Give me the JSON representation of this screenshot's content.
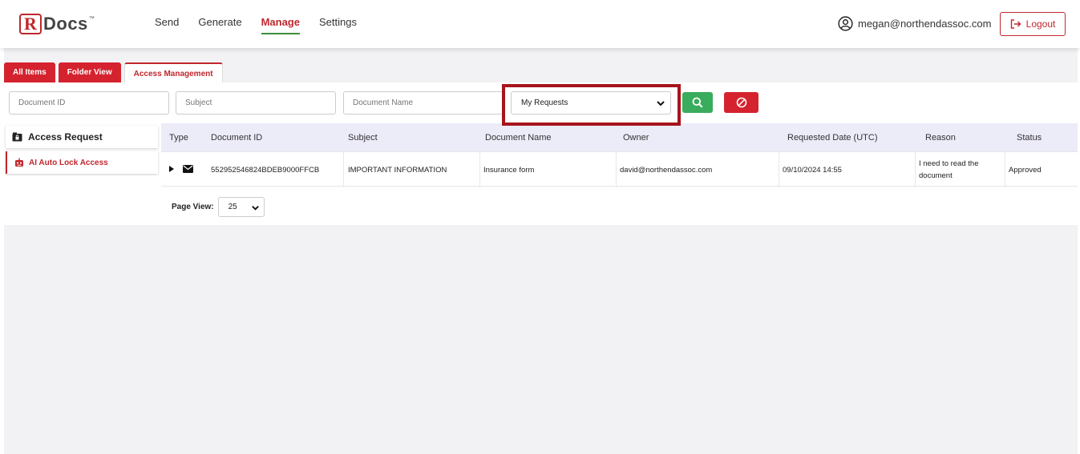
{
  "brand": {
    "logo_r": "R",
    "logo_text": "Docs",
    "logo_tm": "™"
  },
  "nav": {
    "items": [
      {
        "label": "Send",
        "active": false
      },
      {
        "label": "Generate",
        "active": false
      },
      {
        "label": "Manage",
        "active": true
      },
      {
        "label": "Settings",
        "active": false
      }
    ]
  },
  "user": {
    "email": "megan@northendassoc.com",
    "logout_label": "Logout"
  },
  "tabs": [
    {
      "label": "All Items",
      "active": false
    },
    {
      "label": "Folder View",
      "active": false
    },
    {
      "label": "Access Management",
      "active": true
    }
  ],
  "filters": {
    "document_id_placeholder": "Document ID",
    "subject_placeholder": "Subject",
    "document_name_placeholder": "Document Name",
    "request_filter_value": "My Requests"
  },
  "left_panel": {
    "title": "Access Request",
    "items": [
      {
        "label": "AI Auto Lock Access"
      }
    ]
  },
  "table": {
    "headers": [
      "Type",
      "Document ID",
      "Subject",
      "Document Name",
      "Owner",
      "Requested Date (UTC)",
      "Reason",
      "Status"
    ],
    "rows": [
      {
        "type_icon": "mail-icon",
        "document_id": "552952546824BDEB9000FFCB",
        "subject": "IMPORTANT INFORMATION",
        "document_name": "Insurance form",
        "owner": "david@northendassoc.com",
        "requested_date": "09/10/2024 14:55",
        "reason": "I need to read the document",
        "status": "Approved"
      }
    ]
  },
  "pagination": {
    "label": "Page View:",
    "value": "25"
  },
  "colors": {
    "brand_red": "#c0272d",
    "search_green": "#3aac5d",
    "header_row": "#ecebf8",
    "highlight": "#a6141c"
  }
}
